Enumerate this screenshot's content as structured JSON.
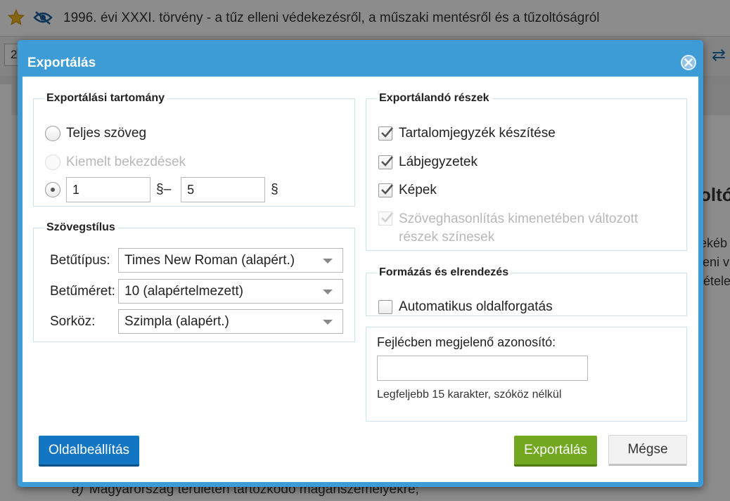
{
  "background": {
    "document_title": "1996. évi XXXI. törvény - a tűz elleni védekezésről, a műszaki mentésről és a tűzoltóságról",
    "toolbar_input_value": "2",
    "partial_heading": "oltó",
    "partial_lines": [
      "ekéb",
      "leni v",
      "tétele"
    ],
    "bottom_item_marker": "a)",
    "bottom_item_text": "Magyarország területén tartózkodó magánszemélyekre;"
  },
  "dialog": {
    "title": "Exportálás",
    "export_range": {
      "legend": "Exportálási tartomány",
      "full_text_label": "Teljes szöveg",
      "highlighted_label": "Kiemelt bekezdések",
      "from_value": "1",
      "from_suffix": "§–",
      "to_value": "5",
      "to_suffix": "§"
    },
    "text_style": {
      "legend": "Szövegstílus",
      "font_label": "Betűtípus:",
      "font_value": "Times New Roman (alapért.)",
      "size_label": "Betűméret:",
      "size_value": "10 (alapértelmezett)",
      "spacing_label": "Sorköz:",
      "spacing_value": "Szimpla (alapért.)"
    },
    "parts": {
      "legend": "Exportálandó részek",
      "toc_label": "Tartalomjegyzék készítése",
      "footnotes_label": "Lábjegyzetek",
      "images_label": "Képek",
      "compare_label_line1": "Szöveghasonlítás kimenetében változott",
      "compare_label_line2": "részek színesek"
    },
    "format": {
      "legend": "Formázás és elrendezés",
      "auto_rotate_label": "Automatikus oldalforgatás"
    },
    "header_id": {
      "label": "Fejlécben megjelenő azonosító:",
      "value": "",
      "hint": "Legfeljebb 15 karakter, szóköz nélkül"
    },
    "buttons": {
      "page_setup": "Oldalbeállítás",
      "export": "Exportálás",
      "cancel": "Mégse"
    }
  },
  "colors": {
    "dialog_frame": "#3d9bd6",
    "primary_button": "#1376c2",
    "export_button": "#72a81f"
  },
  "icons": [
    "star-icon",
    "eye-off-icon",
    "swap-icon",
    "close-icon",
    "checkmark-icon"
  ]
}
